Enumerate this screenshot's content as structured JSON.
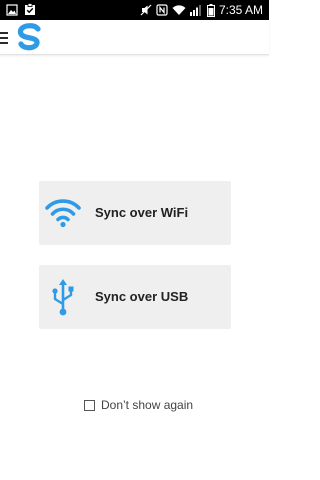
{
  "status_bar": {
    "time": "7:35 AM",
    "left_icons": [
      "image-icon",
      "clipboard-check-icon"
    ],
    "right_icons": [
      "mute-icon",
      "nfc-icon",
      "wifi-icon",
      "signal-icon",
      "battery-icon"
    ]
  },
  "app_bar": {
    "menu_icon": "hamburger-icon",
    "logo_icon": "app-logo-icon"
  },
  "options": [
    {
      "label": "Sync over WiFi",
      "icon": "wifi-icon"
    },
    {
      "label": "Sync over USB",
      "icon": "usb-icon"
    }
  ],
  "dont_show": {
    "label": "Don’t show again",
    "checked": false
  },
  "colors": {
    "accent": "#2f9be6",
    "card_bg": "#efefef",
    "status_bar_bg": "#000000"
  }
}
